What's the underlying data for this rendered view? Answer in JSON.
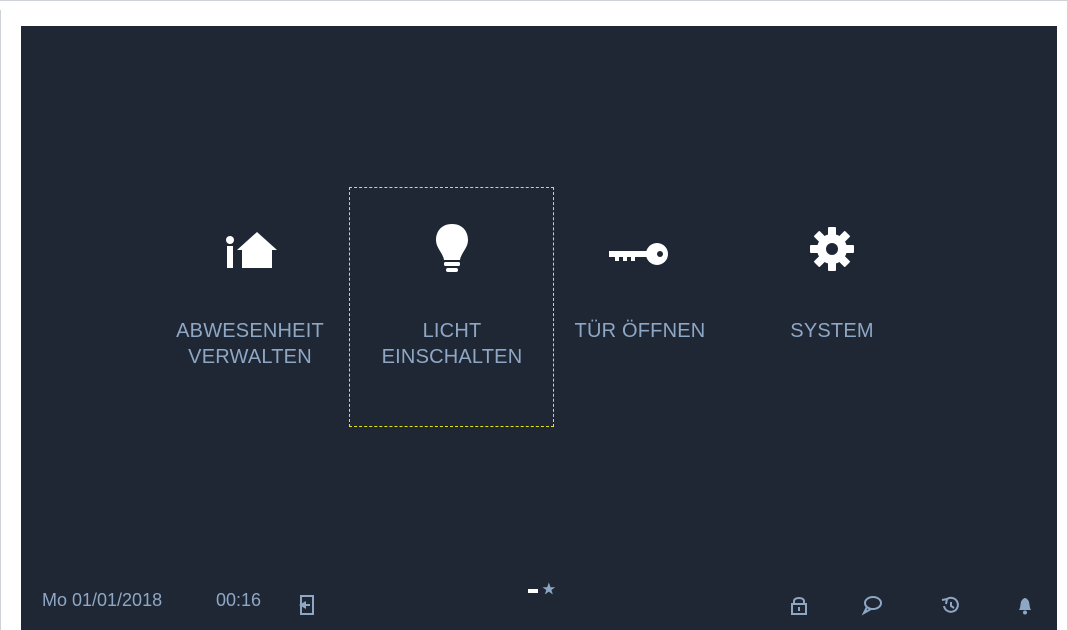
{
  "home_tiles": [
    {
      "name": "abwesenheit-verwalten",
      "icon": "away-home-icon",
      "line1": "ABWESENHEIT",
      "line2": "VERWALTEN"
    },
    {
      "name": "licht-einschalten",
      "icon": "light-bulb-icon",
      "line1": "LICHT",
      "line2": "EINSCHALTEN"
    },
    {
      "name": "tuer-oeffnen",
      "icon": "key-icon",
      "line1": "TÜR ÖFFNEN",
      "line2": ""
    },
    {
      "name": "system",
      "icon": "gear-icon",
      "line1": "SYSTEM",
      "line2": ""
    }
  ],
  "focused_tile": "licht-einschalten",
  "pager": {
    "pages": 2,
    "current": 1
  },
  "status_bar": {
    "date": "Mo 01/01/2018",
    "time": "00:16",
    "icons": [
      "exit-icon",
      "lock-icon",
      "message-icon",
      "history-icon",
      "bell-icon"
    ]
  },
  "colors": {
    "background": "#1f2735",
    "text": "#8ea7c4",
    "icon": "#ffffff",
    "focus": "#e6e21a"
  }
}
